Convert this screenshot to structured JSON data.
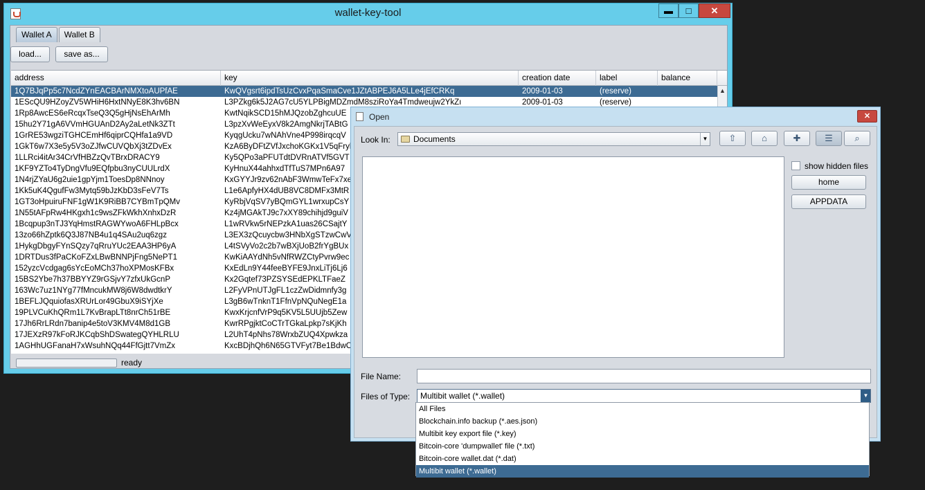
{
  "window": {
    "title": "wallet-key-tool",
    "minimize": "▬",
    "maximize": "□",
    "close": "✕"
  },
  "tabs": [
    {
      "label": "Wallet A"
    },
    {
      "label": "Wallet B"
    }
  ],
  "toolbar": {
    "load_label": "load...",
    "saveas_label": "save as..."
  },
  "table": {
    "columns": [
      "address",
      "key",
      "creation date",
      "label",
      "balance"
    ],
    "rows": [
      {
        "address": "1Q7BJqPp5c7NcdZYnEACBArNMXtoAUPfAE",
        "key": "KwQVgsrt6ipdTsUzCvxPqaSmaCve1JZtABPEJ6A5LLe4jEfCRKq",
        "date": "2009-01-03",
        "label": "(reserve)",
        "balance": ""
      },
      {
        "address": "1EScQU9HZoyZV5WHiH6HxtNNyE8K3hv6BN",
        "key": "L3PZkg6k5J2AG7cU5YLPBigMDZmdM8sziRoYa4Tmdweujw2YkZı",
        "date": "2009-01-03",
        "label": "(reserve)",
        "balance": ""
      },
      {
        "address": "1Rp8AwcES6eRcqxTseQ3Q5gHjNsEhArMh",
        "key": "KwtNqikSCD15hMJQzobZghcuUE",
        "date": "",
        "label": "",
        "balance": ""
      },
      {
        "address": "15hu2Y71gA6VVmHGUAnD2Ay2aLetNk3ZTt",
        "key": "L3pzXvWeEyxV8k2AmgNkrjTABtG",
        "date": "",
        "label": "",
        "balance": ""
      },
      {
        "address": "1GrRE53wgziTGHCEmHf6qiprCQHfa1a9VD",
        "key": "KyqgUcku7wNAhVne4P998irqcqV",
        "date": "",
        "label": "",
        "balance": ""
      },
      {
        "address": "1GkT6w7X3e5y5V3oZJfwCUVQbXj3tZDvEx",
        "key": "KzA6ByDFtZVfJxchoKGKx1V5qFryl",
        "date": "",
        "label": "",
        "balance": ""
      },
      {
        "address": "1LLRci4itAr34CrVfHBZzQvTBrxDRACY9",
        "key": "Ky5QPo3aPFUTdtDVRnATVf5GVT",
        "date": "",
        "label": "",
        "balance": ""
      },
      {
        "address": "1KF9YZTo4TyDngVfu9EQfpbu3nyCUULrdX",
        "key": "KyHnuX44ahhxdTfTuS7MPn6A97",
        "date": "",
        "label": "",
        "balance": ""
      },
      {
        "address": "1N4rjZYaU6g2uie1gpYjm1ToesDp8NNnoy",
        "key": "KxGYYJr9zv62nAbF3WmwTeFx7xe",
        "date": "",
        "label": "",
        "balance": ""
      },
      {
        "address": "1Kk5uK4QgufFw3Mytq59bJzKbD3sFeV7Ts",
        "key": "L1e6ApfyHX4dUB8VC8DMFx3MtR",
        "date": "",
        "label": "",
        "balance": ""
      },
      {
        "address": "1GT3oHpuiruFNF1gW1K9RiBB7CYBmTpQMv",
        "key": "KyRbjVqSV7yBQmGYL1wrxupCsY",
        "date": "",
        "label": "",
        "balance": ""
      },
      {
        "address": "1N55tAFpRw4HKgxh1c9wsZFkWkhXnhxDzR",
        "key": "Kz4jMGAkTJ9c7xXY89chihjd9guiV",
        "date": "",
        "label": "",
        "balance": ""
      },
      {
        "address": "1Bcqpup3nTJ3YqHmstRAGWYwoA6FHLpBcx",
        "key": "L1wRVkw5rNEPzkA1uas26CSajtY",
        "date": "",
        "label": "",
        "balance": ""
      },
      {
        "address": "13zo66hZptk6Q3J87NB4u1q4SAu2uq6zgz",
        "key": "L3EX3zQcuycbw3HNbXgSTzwCwV",
        "date": "",
        "label": "",
        "balance": ""
      },
      {
        "address": "1HykgDbgyFYnSQzy7qRruYUc2EAA3HP6yA",
        "key": "L4tSVyVo2c2b7wBXjUoB2frYgBUx",
        "date": "",
        "label": "",
        "balance": ""
      },
      {
        "address": "1DRTDus3fPaCKoFZxLBwBNNPjFng5NePT1",
        "key": "KwKiAAYdNh5vNfRWZCtyPvrw9ec",
        "date": "",
        "label": "",
        "balance": ""
      },
      {
        "address": "152yzcVcdgag6sYcEoMCh37hoXPMosKFBx",
        "key": "KxEdLn9Y44feeBYFE9JnxLiTj6Lj6",
        "date": "",
        "label": "",
        "balance": ""
      },
      {
        "address": "15BS2Ybe7h37BBYYZ9rGSjvY7zfxUkGcnP",
        "key": "Kx2Gqtef73PZSYSEdEPKLTFaeZ",
        "date": "",
        "label": "",
        "balance": ""
      },
      {
        "address": "163Wc7uz1NYg77fMncukMW8j6W8dwdtkrY",
        "key": "L2FyVPnUTJgFL1czZwDidmnfy3g",
        "date": "",
        "label": "",
        "balance": ""
      },
      {
        "address": "1BEFLJQquiofasXRUrLor49GbuX9iSYjXe",
        "key": "L3gB6wTnknT1FfnVpNQuNegE1a",
        "date": "",
        "label": "",
        "balance": ""
      },
      {
        "address": "19PLVCuKhQRm1L7KvBrapLTt8nrCh51rBE",
        "key": "KwxKrjcnfVrP9q5KV5L5UUjb5Zew",
        "date": "",
        "label": "",
        "balance": ""
      },
      {
        "address": "17Jh6RrLRdn7banip4e5toV3KMV4M8d1GB",
        "key": "KwrRPgjktCoCTrTGkaLpkp7sKjKh",
        "date": "",
        "label": "",
        "balance": ""
      },
      {
        "address": "17JEXzR97kFoRJKCqbShDSwategQYHLRLU",
        "key": "L2UhT4pNhs78WrxbZUQ4Xpwkza",
        "date": "",
        "label": "",
        "balance": ""
      },
      {
        "address": "1AGHhUGFanaH7xWsuhNQq44FfGjtt7VmZx",
        "key": "KxcBDjhQh6N65GTVFyt7Be1BdwC",
        "date": "",
        "label": "",
        "balance": ""
      }
    ]
  },
  "status": {
    "text": "ready"
  },
  "dialog": {
    "title": "Open",
    "close": "✕",
    "look_in_label": "Look In:",
    "look_in_value": "Documents",
    "show_hidden_label": "show hidden files",
    "home_button": "home",
    "appdata_button": "APPDATA",
    "file_name_label": "File Name:",
    "files_of_type_label": "Files of Type:",
    "files_of_type_value": "Multibit wallet (*.wallet)",
    "type_options": [
      "All Files",
      "Blockchain.info backup (*.aes.json)",
      "Multibit key export file (*.key)",
      "Bitcoin-core 'dumpwallet' file (*.txt)",
      "Bitcoin-core wallet.dat (*.dat)",
      "Multibit wallet (*.wallet)"
    ]
  }
}
